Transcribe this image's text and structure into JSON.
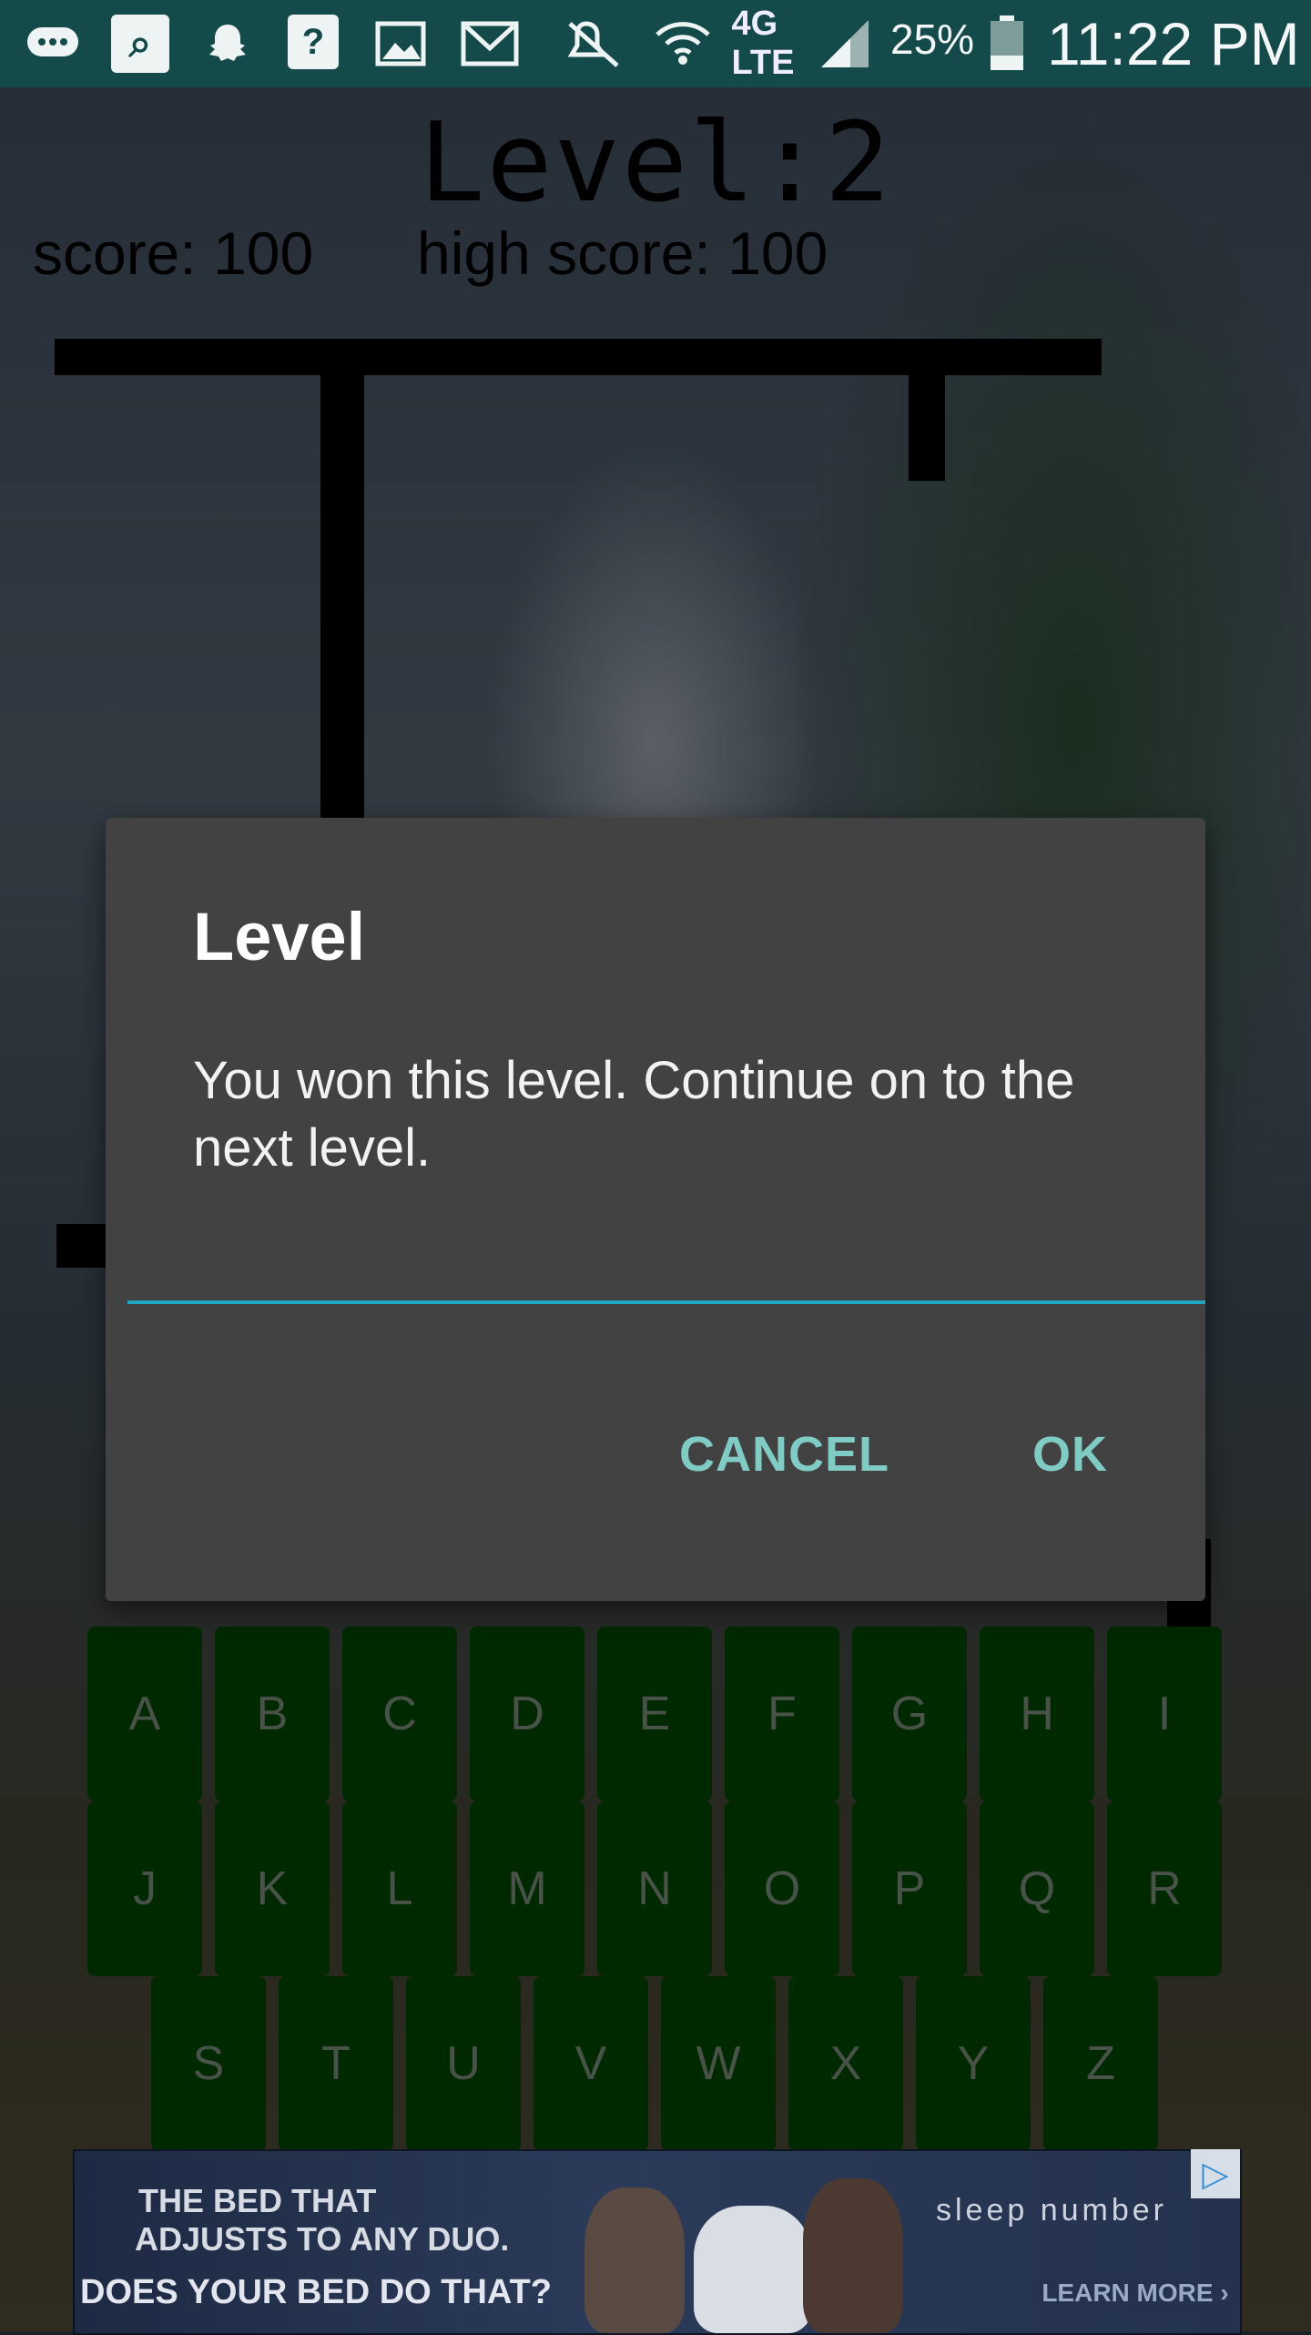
{
  "status_bar": {
    "battery_percent": "25%",
    "time": "11:22 PM",
    "network": "4G LTE",
    "icons": [
      "messages-icon",
      "search-app-icon",
      "snapchat-icon",
      "help-icon",
      "gallery-icon",
      "gmail-icon",
      "mute-icon",
      "wifi-icon",
      "lte-icon",
      "signal-icon",
      "battery-icon"
    ]
  },
  "game": {
    "level_title": "Level:2",
    "score": "score: 100",
    "high_score": "high score: 100"
  },
  "dialog": {
    "title": "Level",
    "message": "You won this level. Continue on to the next level.",
    "input_value": "",
    "cancel_label": "CANCEL",
    "ok_label": "OK",
    "accent_color": "#80cbc4"
  },
  "keyboard": {
    "rows": [
      [
        "A",
        "B",
        "C",
        "D",
        "E",
        "F",
        "G",
        "H",
        "I"
      ],
      [
        "J",
        "K",
        "L",
        "M",
        "N",
        "O",
        "P",
        "Q",
        "R"
      ],
      [
        "S",
        "T",
        "U",
        "V",
        "W",
        "X",
        "Y",
        "Z"
      ]
    ],
    "key_color": "#003f00"
  },
  "ad": {
    "headline_line1": "THE BED THAT",
    "headline_line2": "ADJUSTS TO ANY DUO.",
    "cta_text": "DOES YOUR BED DO THAT?",
    "brand": "sleep number",
    "learn_more": "LEARN MORE ›"
  }
}
